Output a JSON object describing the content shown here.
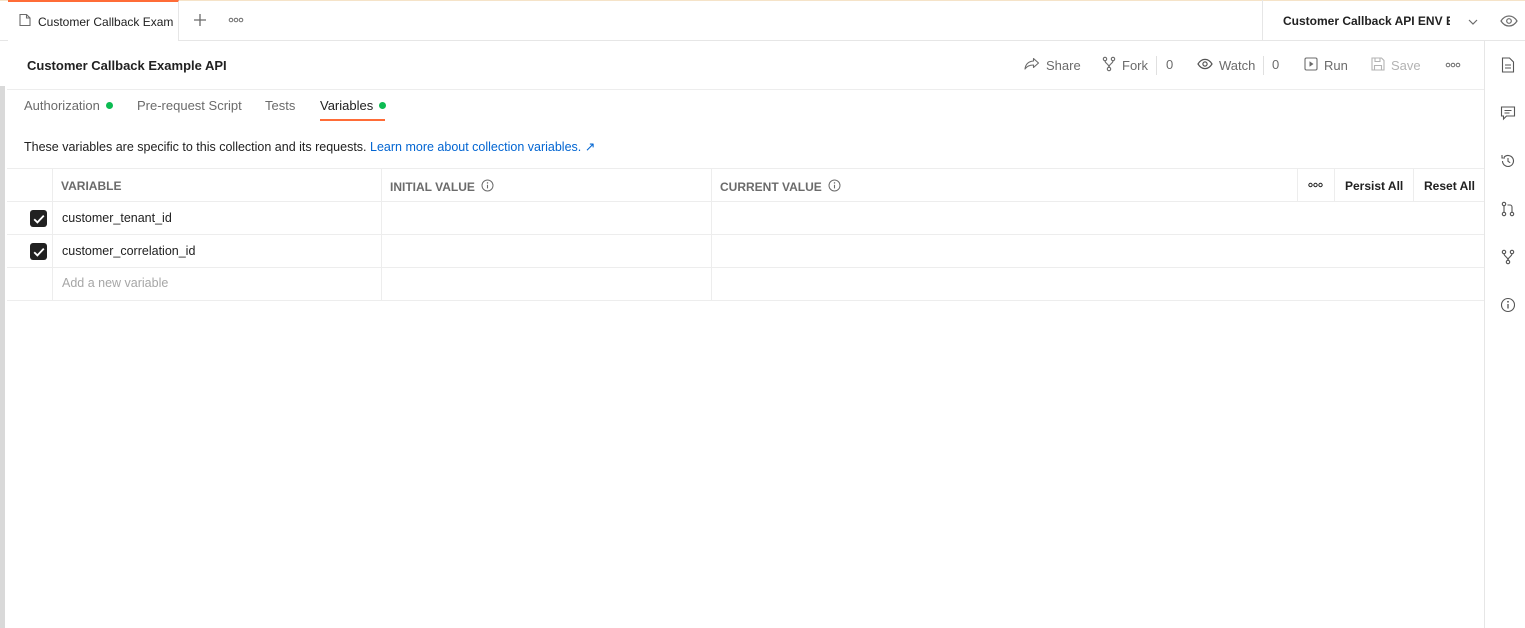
{
  "tabbar": {
    "active_tab_title": "Customer Callback Example API",
    "environment": "Customer Callback API ENV Example"
  },
  "header": {
    "title": "Customer Callback Example API",
    "share_label": "Share",
    "fork_label": "Fork",
    "fork_count": "0",
    "watch_label": "Watch",
    "watch_count": "0",
    "run_label": "Run",
    "save_label": "Save"
  },
  "subtabs": [
    {
      "label": "Authorization",
      "has_dot": true
    },
    {
      "label": "Pre-request Script",
      "has_dot": false
    },
    {
      "label": "Tests",
      "has_dot": false
    },
    {
      "label": "Variables",
      "has_dot": true,
      "active": true
    }
  ],
  "description": {
    "text": "These variables are specific to this collection and its requests.",
    "link": "Learn more about collection variables. ↗"
  },
  "table": {
    "columns": [
      "VARIABLE",
      "INITIAL VALUE",
      "CURRENT VALUE"
    ],
    "persist_all": "Persist All",
    "reset_all": "Reset All",
    "rows": [
      {
        "checked": true,
        "variable": "customer_tenant_id",
        "initial": "",
        "current": ""
      },
      {
        "checked": true,
        "variable": "customer_correlation_id",
        "initial": "",
        "current": ""
      }
    ],
    "new_placeholder": "Add a new variable"
  },
  "colors": {
    "accent": "#ff6c37",
    "status_dot": "#0cbb52",
    "link": "#0265d2"
  }
}
